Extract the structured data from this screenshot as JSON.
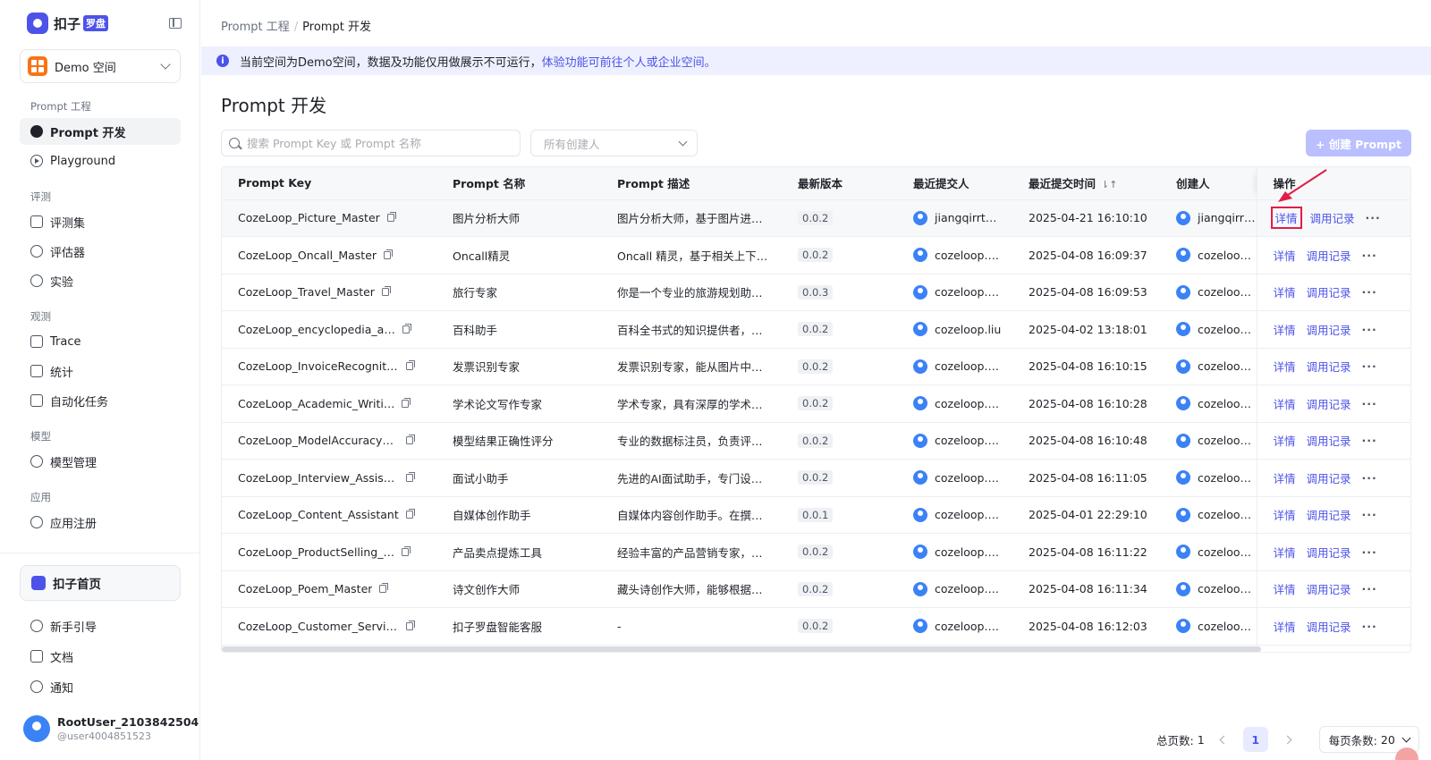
{
  "brand": {
    "name": "扣子",
    "badge": "罗盘"
  },
  "space": {
    "label": "Demo 空间"
  },
  "nav": {
    "groups": [
      {
        "title": "Prompt 工程",
        "items": [
          "Prompt 开发",
          "Playground"
        ]
      },
      {
        "title": "评测",
        "items": [
          "评测集",
          "评估器",
          "实验"
        ]
      },
      {
        "title": "观测",
        "items": [
          "Trace",
          "统计",
          "自动化任务"
        ]
      },
      {
        "title": "模型",
        "items": [
          "模型管理"
        ]
      },
      {
        "title": "应用",
        "items": [
          "应用注册"
        ]
      }
    ],
    "home": "扣子首页",
    "bottom": [
      "新手引导",
      "文档",
      "通知"
    ]
  },
  "user": {
    "name": "RootUser_2103842504",
    "id": "@user4004851523"
  },
  "breadcrumb": {
    "parent": "Prompt 工程",
    "sep": "/",
    "current": "Prompt 开发"
  },
  "banner": {
    "text": "当前空间为Demo空间，数据及功能仅用做展示不可运行，",
    "link": "体验功能可前往个人或企业空间。"
  },
  "page": {
    "title": "Prompt 开发"
  },
  "search": {
    "placeholder": "搜索 Prompt Key 或 Prompt 名称"
  },
  "creator_filter": {
    "placeholder": "所有创建人"
  },
  "create_button": "+ 创建 Prompt",
  "table": {
    "headers": [
      "Prompt Key",
      "Prompt 名称",
      "Prompt 描述",
      "最新版本",
      "最近提交人",
      "最近提交时间",
      "创建人",
      "操作"
    ],
    "sort_icon": "⇂↑",
    "ops": {
      "detail": "详情",
      "log": "调用记录",
      "more": "···"
    },
    "rows": [
      {
        "key": "CozeLoop_Picture_Master",
        "name": "图片分析大师",
        "desc": "图片分析大师，基于图片进…",
        "version": "0.0.2",
        "committer": "jiangqirrt…",
        "time": "2025-04-21 16:10:10",
        "creator": "jiangqirrt…"
      },
      {
        "key": "CozeLoop_Oncall_Master",
        "name": "Oncall精灵",
        "desc": "Oncall 精灵，基于相关上下…",
        "version": "0.0.2",
        "committer": "cozeloop.…",
        "time": "2025-04-08 16:09:37",
        "creator": "cozeloop.…"
      },
      {
        "key": "CozeLoop_Travel_Master",
        "name": "旅行专家",
        "desc": "你是一个专业的旅游规划助…",
        "version": "0.0.3",
        "committer": "cozeloop.…",
        "time": "2025-04-08 16:09:53",
        "creator": "cozeloop.…"
      },
      {
        "key": "CozeLoop_encyclopedia_a…",
        "name": "百科助手",
        "desc": "百科全书式的知识提供者，…",
        "version": "0.0.2",
        "committer": "cozeloop.liu",
        "time": "2025-04-02 13:18:01",
        "creator": "cozeloop.liu"
      },
      {
        "key": "CozeLoop_InvoiceRecogniti…",
        "name": "发票识别专家",
        "desc": "发票识别专家，能从图片中…",
        "version": "0.0.2",
        "committer": "cozeloop.…",
        "time": "2025-04-08 16:10:15",
        "creator": "cozeloop.…"
      },
      {
        "key": "CozeLoop_Academic_Writi…",
        "name": "学术论文写作专家",
        "desc": "学术专家，具有深厚的学术…",
        "version": "0.0.2",
        "committer": "cozeloop.…",
        "time": "2025-04-08 16:10:28",
        "creator": "cozeloop.…"
      },
      {
        "key": "CozeLoop_ModelAccuracy_…",
        "name": "模型结果正确性评分",
        "desc": "专业的数据标注员，负责评…",
        "version": "0.0.2",
        "committer": "cozeloop.…",
        "time": "2025-04-08 16:10:48",
        "creator": "cozeloop.…"
      },
      {
        "key": "CozeLoop_Interview_Assist…",
        "name": "面试小助手",
        "desc": "先进的AI面试助手，专门设…",
        "version": "0.0.2",
        "committer": "cozeloop.…",
        "time": "2025-04-08 16:11:05",
        "creator": "cozeloop.…"
      },
      {
        "key": "CozeLoop_Content_Assistant",
        "name": "自媒体创作助手",
        "desc": "自媒体内容创作助手。在撰…",
        "version": "0.0.1",
        "committer": "cozeloop.…",
        "time": "2025-04-01 22:29:10",
        "creator": "cozeloop.…"
      },
      {
        "key": "CozeLoop_ProductSelling_…",
        "name": "产品卖点提炼工具",
        "desc": "经验丰富的产品营销专家，…",
        "version": "0.0.2",
        "committer": "cozeloop.…",
        "time": "2025-04-08 16:11:22",
        "creator": "cozeloop.…"
      },
      {
        "key": "CozeLoop_Poem_Master",
        "name": "诗文创作大师",
        "desc": "藏头诗创作大师，能够根据…",
        "version": "0.0.2",
        "committer": "cozeloop.…",
        "time": "2025-04-08 16:11:34",
        "creator": "cozeloop.…"
      },
      {
        "key": "CozeLoop_Customer_Service",
        "name": "扣子罗盘智能客服",
        "desc": "-",
        "version": "0.0.2",
        "committer": "cozeloop.…",
        "time": "2025-04-08 16:12:03",
        "creator": "cozeloop.…"
      }
    ]
  },
  "pagination": {
    "total_label": "总页数:",
    "total": "1",
    "current": "1",
    "per_page_label": "每页条数:",
    "per_page": "20"
  },
  "colors": {
    "accent": "#4d53e8",
    "highlight_box": "#e11d48"
  }
}
